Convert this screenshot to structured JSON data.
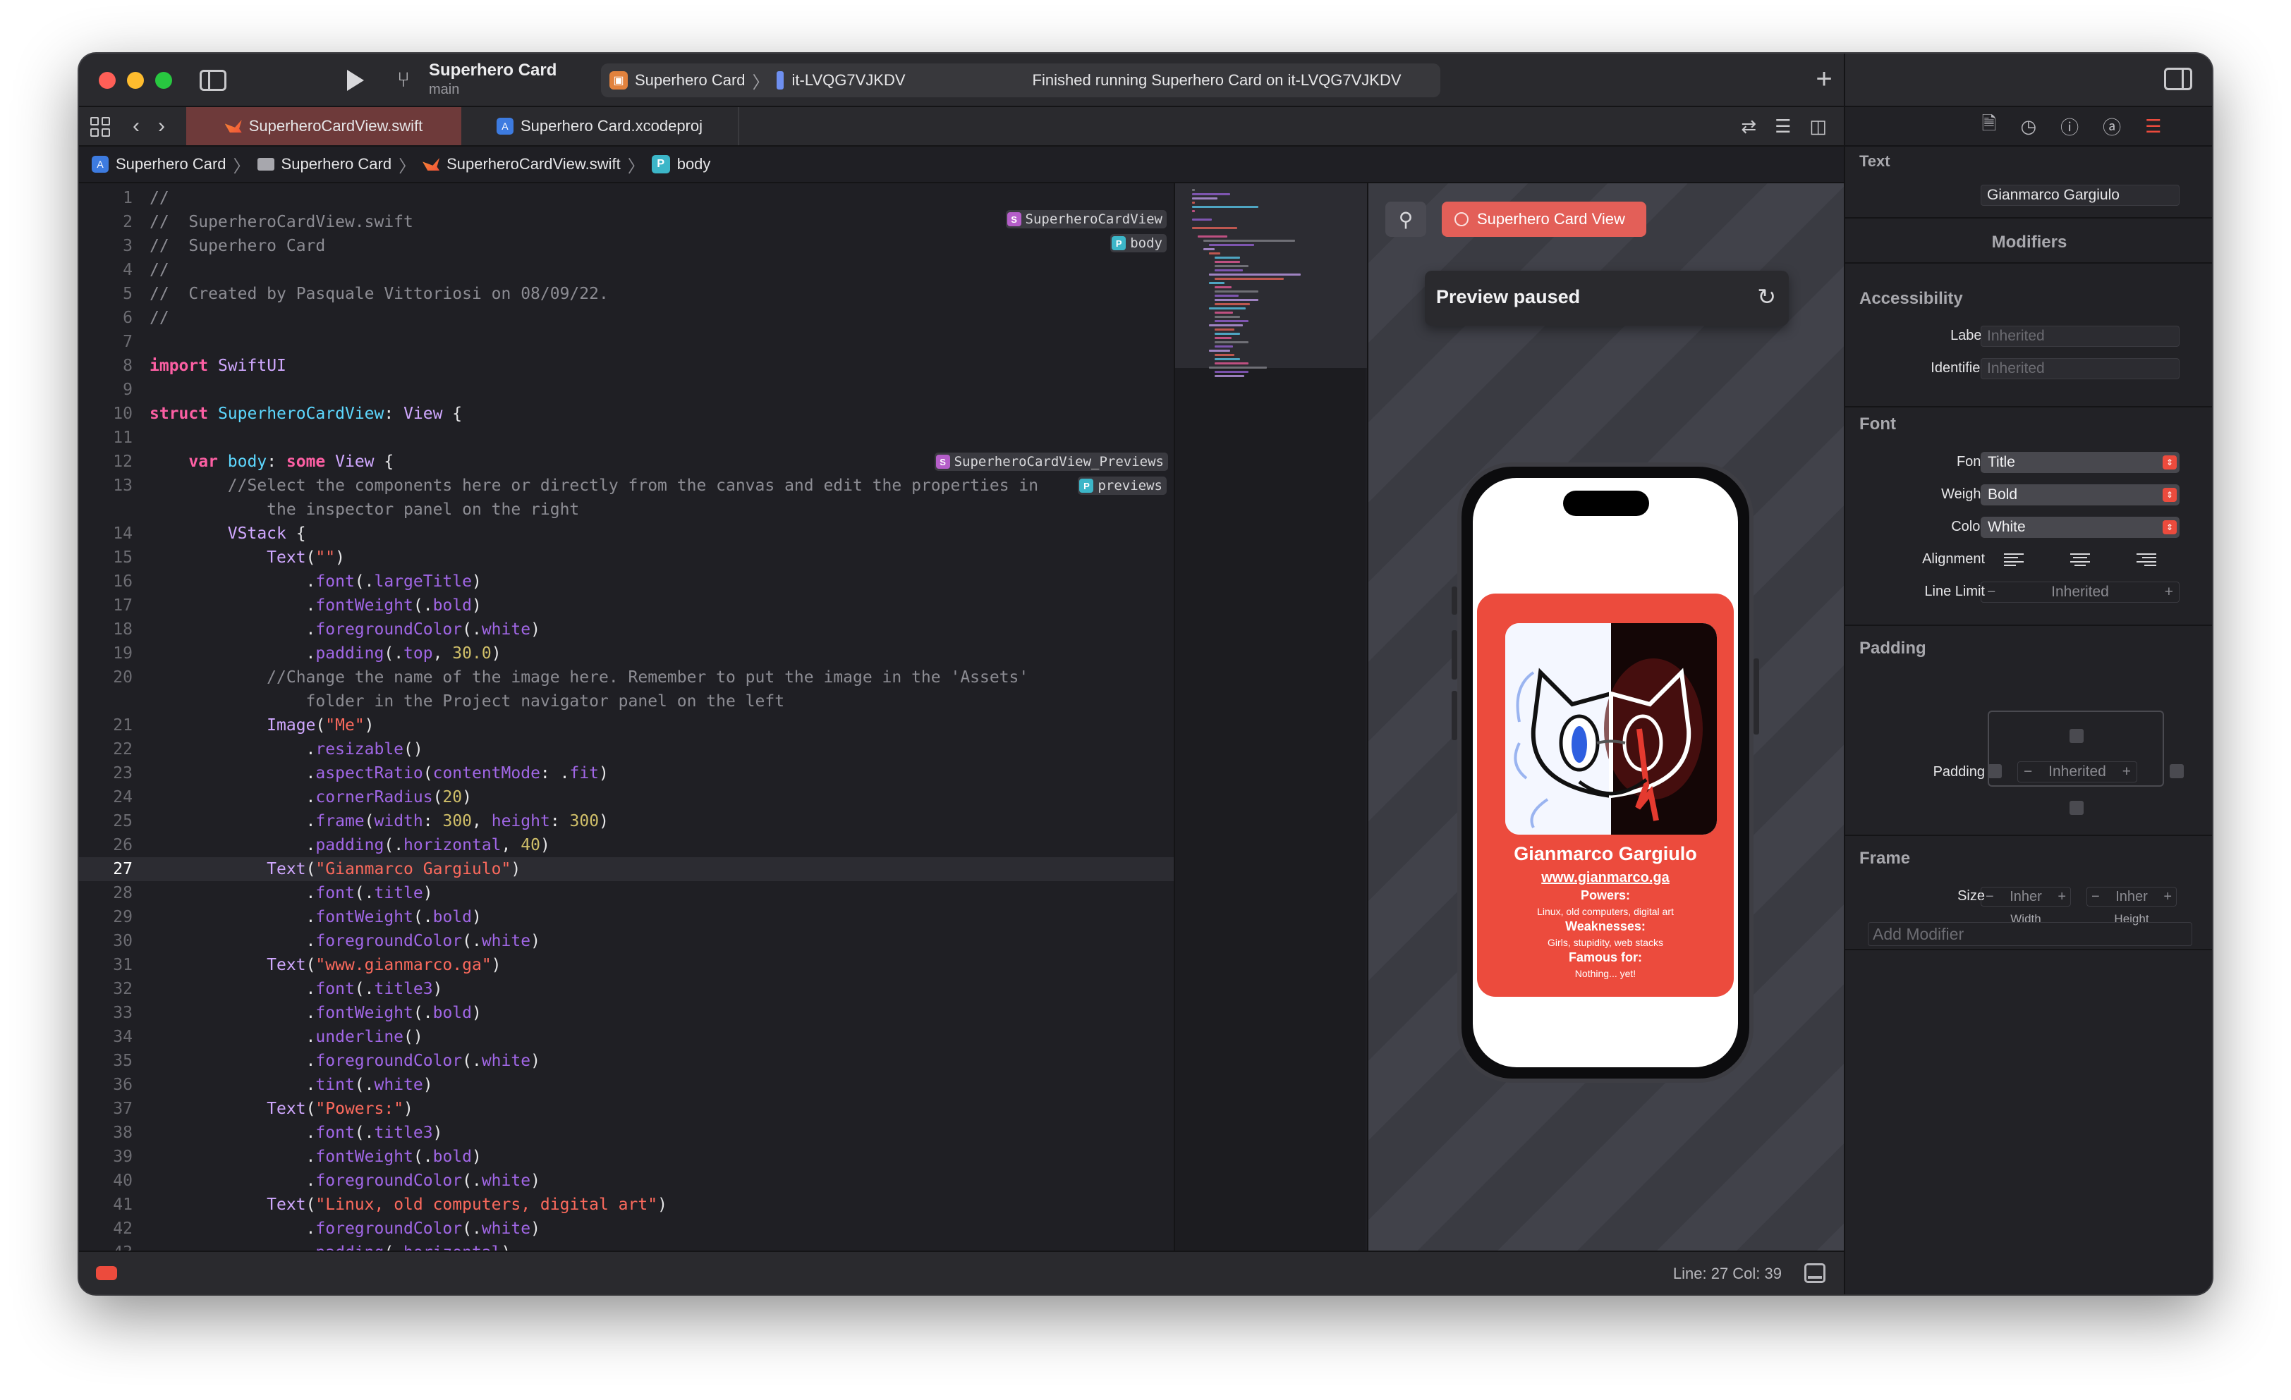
{
  "titlebar": {
    "project_title": "Superhero Card",
    "branch": "main",
    "scheme": "Superhero Card",
    "device": "it-LVQG7VJKDV",
    "status": "Finished running Superhero Card on it-LVQG7VJKDV"
  },
  "tabs": [
    {
      "label": "SuperheroCardView.swift",
      "active": true
    },
    {
      "label": "Superhero Card.xcodeproj",
      "active": false
    }
  ],
  "breadcrumb": [
    "Superhero Card",
    "Superhero Card",
    "SuperheroCardView.swift",
    "body"
  ],
  "code_lines": [
    {
      "n": "1",
      "text": "//"
    },
    {
      "n": "2",
      "text": "//  SuperheroCardView.swift"
    },
    {
      "n": "3",
      "text": "//  Superhero Card"
    },
    {
      "n": "4",
      "text": "//"
    },
    {
      "n": "5",
      "text": "//  Created by Pasquale Vittoriosi on 08/09/22."
    },
    {
      "n": "6",
      "text": "//"
    },
    {
      "n": "7",
      "text": ""
    },
    {
      "n": "8",
      "text": "import SwiftUI"
    },
    {
      "n": "9",
      "text": ""
    },
    {
      "n": "10",
      "text": "struct SuperheroCardView: View {"
    },
    {
      "n": "11",
      "text": ""
    },
    {
      "n": "12",
      "text": "    var body: some View {"
    },
    {
      "n": "13",
      "text": "        //Select the components here or directly from the canvas and edit the properties in"
    },
    {
      "n": "",
      "text": "            the inspector panel on the right"
    },
    {
      "n": "14",
      "text": "        VStack {"
    },
    {
      "n": "15",
      "text": "            Text(\"\")"
    },
    {
      "n": "16",
      "text": "                .font(.largeTitle)"
    },
    {
      "n": "17",
      "text": "                .fontWeight(.bold)"
    },
    {
      "n": "18",
      "text": "                .foregroundColor(.white)"
    },
    {
      "n": "19",
      "text": "                .padding(.top, 30.0)"
    },
    {
      "n": "20",
      "text": "            //Change the name of the image here. Remember to put the image in the 'Assets'"
    },
    {
      "n": "",
      "text": "                folder in the Project navigator panel on the left"
    },
    {
      "n": "21",
      "text": "            Image(\"Me\")"
    },
    {
      "n": "22",
      "text": "                .resizable()"
    },
    {
      "n": "23",
      "text": "                .aspectRatio(contentMode: .fit)"
    },
    {
      "n": "24",
      "text": "                .cornerRadius(20)"
    },
    {
      "n": "25",
      "text": "                .frame(width: 300, height: 300)"
    },
    {
      "n": "26",
      "text": "                .padding(.horizontal, 40)"
    },
    {
      "n": "27",
      "text": "            Text(\"Gianmarco Gargiulo\")"
    },
    {
      "n": "28",
      "text": "                .font(.title)"
    },
    {
      "n": "29",
      "text": "                .fontWeight(.bold)"
    },
    {
      "n": "30",
      "text": "                .foregroundColor(.white)"
    },
    {
      "n": "31",
      "text": "            Text(\"www.gianmarco.ga\")"
    },
    {
      "n": "32",
      "text": "                .font(.title3)"
    },
    {
      "n": "33",
      "text": "                .fontWeight(.bold)"
    },
    {
      "n": "34",
      "text": "                .underline()"
    },
    {
      "n": "35",
      "text": "                .foregroundColor(.white)"
    },
    {
      "n": "36",
      "text": "                .tint(.white)"
    },
    {
      "n": "37",
      "text": "            Text(\"Powers:\")"
    },
    {
      "n": "38",
      "text": "                .font(.title3)"
    },
    {
      "n": "39",
      "text": "                .fontWeight(.bold)"
    },
    {
      "n": "40",
      "text": "                .foregroundColor(.white)"
    },
    {
      "n": "41",
      "text": "            Text(\"Linux, old computers, digital art\")"
    },
    {
      "n": "42",
      "text": "                .foregroundColor(.white)"
    },
    {
      "n": "43",
      "text": "                .padding(.horizontal)"
    }
  ],
  "annotations": {
    "struct": "SuperheroCardView",
    "body": "body",
    "previews_struct": "SuperheroCardView_Previews",
    "previews": "previews"
  },
  "canvas": {
    "preview_chip": "Superhero Card View",
    "paused": "Preview paused"
  },
  "card": {
    "name": "Gianmarco Gargiulo",
    "url": "www.gianmarco.ga",
    "powers_title": "Powers:",
    "powers": "Linux, old computers, digital art",
    "weaknesses_title": "Weaknesses:",
    "weaknesses": "Girls, stupidity, web stacks",
    "famous_title": "Famous for:",
    "famous": "Nothing... yet!",
    "color": "#ec4b3d"
  },
  "statusbar": {
    "position": "Line: 27  Col: 39"
  },
  "inspector": {
    "text_title": "Text",
    "text_value": "Gianmarco Gargiulo",
    "modifiers_title": "Modifiers",
    "accessibility_title": "Accessibility",
    "label_label": "Label",
    "label_placeholder": "Inherited",
    "identifier_label": "Identifier",
    "identifier_placeholder": "Inherited",
    "font_title": "Font",
    "font_label": "Font",
    "font_value": "Title",
    "weight_label": "Weight",
    "weight_value": "Bold",
    "color_label": "Color",
    "color_value": "White",
    "alignment_label": "Alignment",
    "line_limit_label": "Line Limit",
    "line_limit_value": "Inherited",
    "padding_title": "Padding",
    "padding_label": "Padding",
    "padding_value": "Inherited",
    "frame_title": "Frame",
    "size_label": "Size",
    "width_value": "Inher",
    "height_value": "Inher",
    "width_caption": "Width",
    "height_caption": "Height",
    "add_modifier": "Add Modifier"
  }
}
